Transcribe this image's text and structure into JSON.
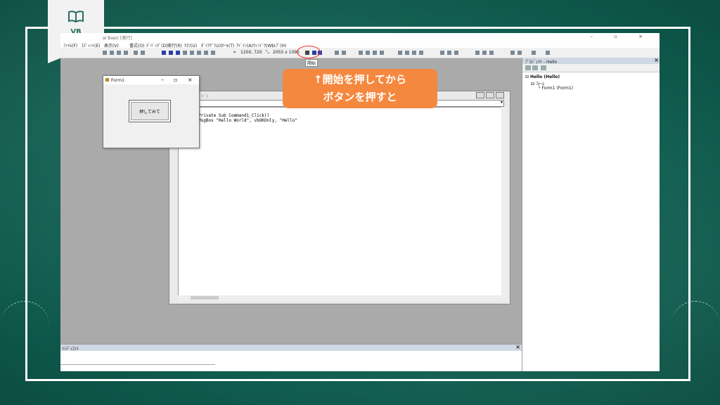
{
  "badge": {
    "label": "VB",
    "icon": "open-book-icon"
  },
  "ide": {
    "window_title": "al Basic [実行]",
    "menu": [
      "ﾌｧｲﾙ(F)",
      "ｴﾃﾞｨｯﾄ(E)",
      "表示(V)",
      "ﾌﾟﾛｼﾞｪｸﾄ(P)",
      "書式(O)",
      "ﾃﾞﾊﾞｯｸﾞ(D)",
      "実行(R)",
      "ｸｴﾘ(U)",
      "ﾀﾞｲｱｸﾞﾗﾑ(I)",
      "ﾂｰﾙ(T)",
      "ｱﾄﾞｲﾝ(A)",
      "ｳｨﾝﾄﾞｳ(W)",
      "ﾍﾙﾌﾟ(H)"
    ],
    "toolbar": {
      "position": "1200, 720",
      "size": "2055 x 1095",
      "tooltip": "開始"
    },
    "project_panel": {
      "title": "ﾌﾟﾛｼﾞｪｸﾄ - Hello",
      "tree": [
        "Hello (Hello)",
        "ﾌｫｰﾑ",
        "Form1 (Form1)"
      ]
    },
    "code_window": {
      "title": "ｺｰﾄﾞ)",
      "lines": [
        "Private Sub Command1_Click()",
        "    MsgBox \"Hello World\", vbOKOnly, \"Hello\""
      ]
    },
    "immediate": {
      "title": "ｲﾐﾃﾞｨｴｲﾄ"
    }
  },
  "form1": {
    "title": "Form1",
    "button_label": "押してみて"
  },
  "callout": {
    "line1": "↑開始を押してから",
    "line2": "ボタンを押すと"
  }
}
